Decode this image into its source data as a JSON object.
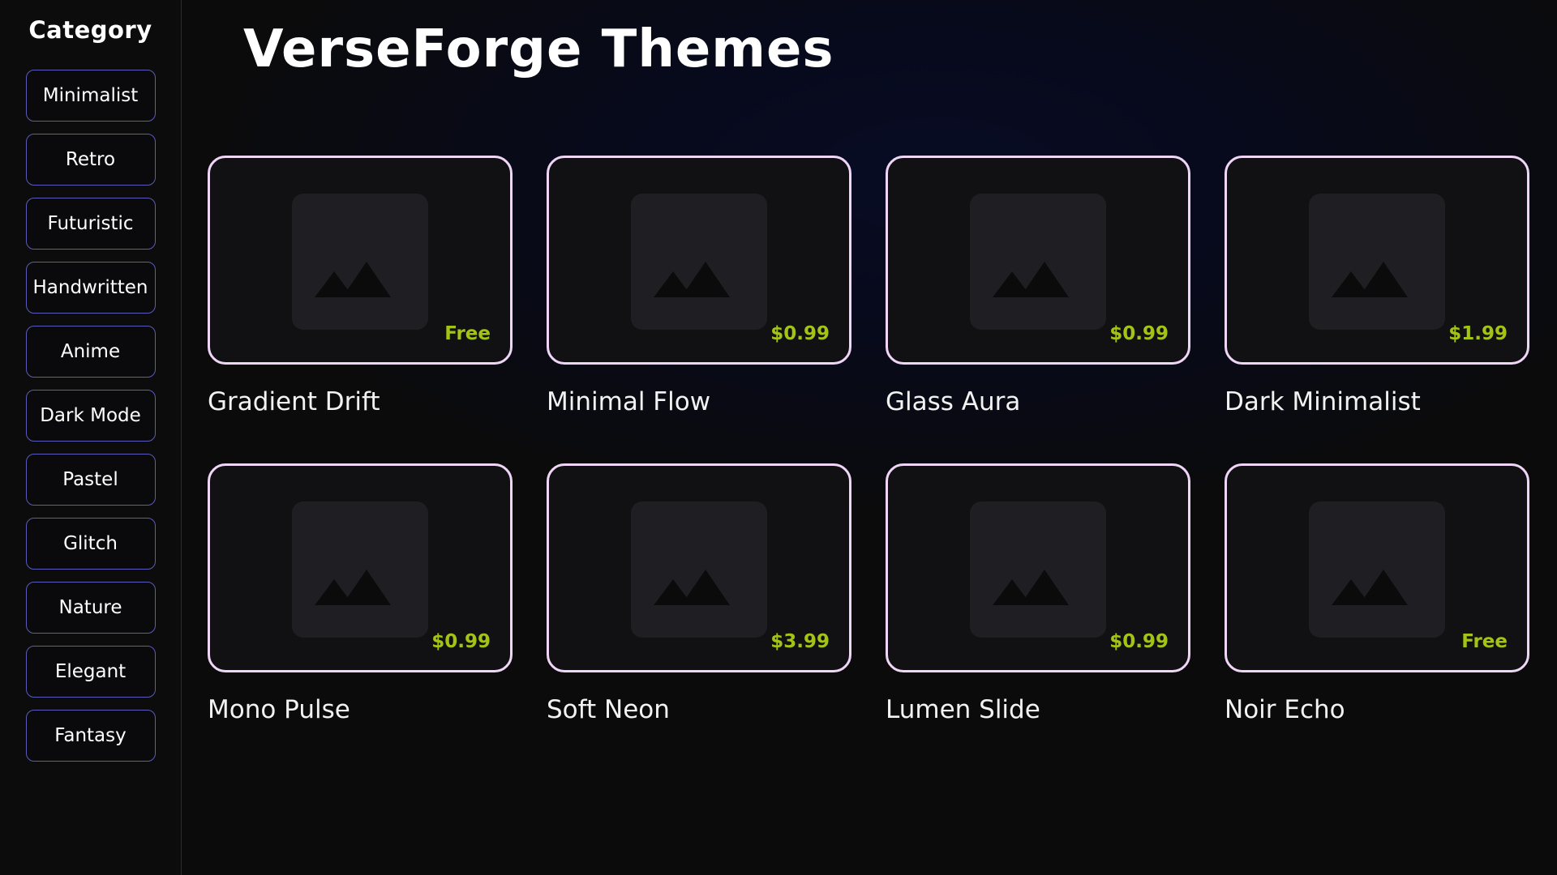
{
  "sidebar": {
    "title": "Category",
    "items": [
      {
        "label": "Minimalist"
      },
      {
        "label": "Retro"
      },
      {
        "label": "Futuristic"
      },
      {
        "label": "Handwritten"
      },
      {
        "label": "Anime"
      },
      {
        "label": "Dark Mode"
      },
      {
        "label": "Pastel"
      },
      {
        "label": "Glitch"
      },
      {
        "label": "Nature"
      },
      {
        "label": "Elegant"
      },
      {
        "label": "Fantasy"
      }
    ]
  },
  "main": {
    "title": "VerseForge Themes",
    "themes": [
      {
        "name": "Gradient Drift",
        "price": "Free",
        "icon": "image-placeholder-icon"
      },
      {
        "name": "Minimal Flow",
        "price": "$0.99",
        "icon": "image-placeholder-icon"
      },
      {
        "name": "Glass Aura",
        "price": "$0.99",
        "icon": "image-placeholder-icon"
      },
      {
        "name": "Dark Minimalist",
        "price": "$1.99",
        "icon": "image-placeholder-icon"
      },
      {
        "name": "Mono Pulse",
        "price": "$0.99",
        "icon": "image-placeholder-icon"
      },
      {
        "name": "Soft Neon",
        "price": "$3.99",
        "icon": "image-placeholder-icon"
      },
      {
        "name": "Lumen Slide",
        "price": "$0.99",
        "icon": "image-placeholder-icon"
      },
      {
        "name": "Noir Echo",
        "price": "Free",
        "icon": "image-placeholder-icon"
      }
    ]
  },
  "colors": {
    "background": "#0b0b0c",
    "card_border": "#f0d6f6",
    "category_border": "#5b5bb8",
    "price": "#a3c414",
    "placeholder": "#1f1f23"
  }
}
